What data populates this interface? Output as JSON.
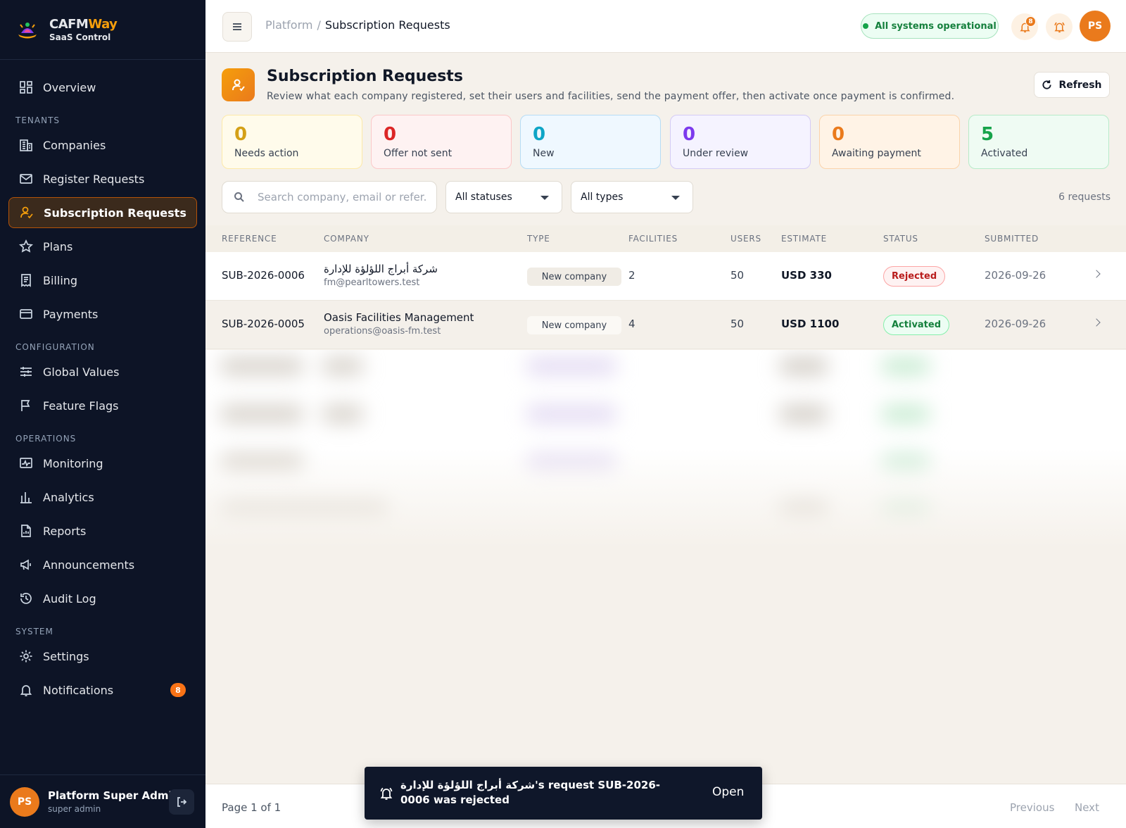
{
  "brand": {
    "name_primary": "CAFM",
    "name_accent": "Way",
    "subtitle": "SaaS Control"
  },
  "sidebar": {
    "overview": "Overview",
    "sections": {
      "tenants": "TENANTS",
      "configuration": "CONFIGURATION",
      "operations": "OPERATIONS",
      "system": "SYSTEM"
    },
    "items": {
      "companies": "Companies",
      "register_requests": "Register Requests",
      "subscription_requests": "Subscription Requests",
      "plans": "Plans",
      "billing": "Billing",
      "payments": "Payments",
      "global_values": "Global Values",
      "feature_flags": "Feature Flags",
      "monitoring": "Monitoring",
      "analytics": "Analytics",
      "reports": "Reports",
      "announcements": "Announcements",
      "audit_log": "Audit Log",
      "settings": "Settings",
      "notifications": "Notifications"
    },
    "notifications_badge": "8",
    "user": {
      "initials": "PS",
      "name": "Platform Super Admin",
      "role": "super admin"
    }
  },
  "topbar": {
    "breadcrumb_root": "Platform",
    "breadcrumb_sep": "/",
    "breadcrumb_current": "Subscription Requests",
    "status": "All systems operational",
    "notif_badge": "8",
    "avatar_initials": "PS"
  },
  "page": {
    "title": "Subscription Requests",
    "subtitle": "Review what each company registered, set their users and facilities, send the payment offer, then activate once payment is confirmed.",
    "refresh_label": "Refresh"
  },
  "stats": [
    {
      "value": "0",
      "label": "Needs action"
    },
    {
      "value": "0",
      "label": "Offer not sent"
    },
    {
      "value": "0",
      "label": "New"
    },
    {
      "value": "0",
      "label": "Under review"
    },
    {
      "value": "0",
      "label": "Awaiting payment"
    },
    {
      "value": "5",
      "label": "Activated"
    }
  ],
  "filters": {
    "search_placeholder": "Search company, email or refer...",
    "status_value": "All statuses",
    "type_value": "All types",
    "count": "6 requests"
  },
  "table": {
    "headers": [
      "REFERENCE",
      "COMPANY",
      "TYPE",
      "FACILITIES",
      "USERS",
      "ESTIMATE",
      "STATUS",
      "SUBMITTED"
    ],
    "rows": [
      {
        "reference": "SUB-2026-0006",
        "company": "شركة أبراج اللؤلؤة للإدارة",
        "email": "fm@pearltowers.test",
        "type": "New company",
        "facilities": "2",
        "users": "50",
        "estimate": "USD 330",
        "status": "Rejected",
        "submitted": "2026-09-26"
      },
      {
        "reference": "SUB-2026-0005",
        "company": "Oasis Facilities Management",
        "email": "operations@oasis-fm.test",
        "type": "New company",
        "facilities": "4",
        "users": "50",
        "estimate": "USD 1100",
        "status": "Activated",
        "submitted": "2026-09-26"
      }
    ]
  },
  "footer": {
    "page_info": "Page 1 of 1",
    "previous": "Previous",
    "next": "Next"
  },
  "toast": {
    "message": "شركة أبراج اللؤلؤة للإدارة's request SUB-2026-0006 was rejected",
    "action": "Open"
  },
  "colors": {
    "sidebar_bg": "#0d1426",
    "accent": "#ea7a1c",
    "needs_action": "#d4a017",
    "offer_not_sent": "#dc2626",
    "new": "#0ea5c6",
    "under_review": "#7c3aed",
    "awaiting_payment": "#ea7a1c",
    "activated": "#16a34a"
  }
}
